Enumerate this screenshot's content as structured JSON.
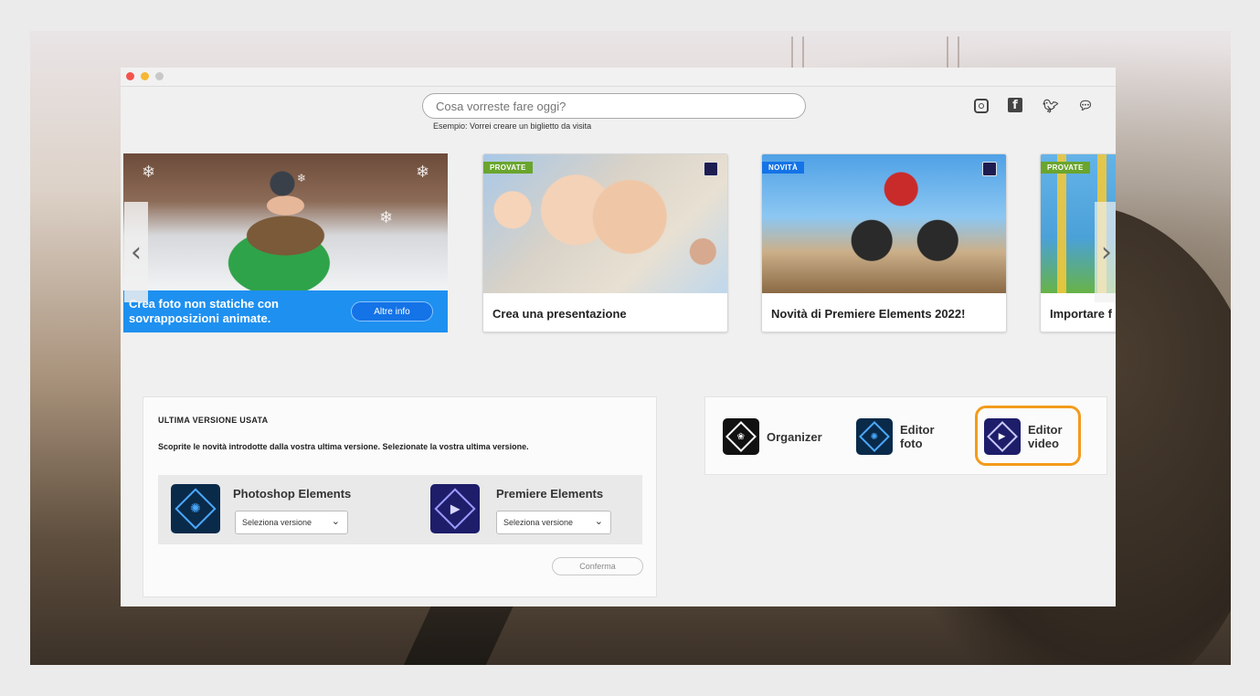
{
  "search": {
    "placeholder": "Cosa vorreste fare oggi?",
    "hint": "Esempio: Vorrei creare un biglietto da visita"
  },
  "social_icons": [
    "instagram-icon",
    "facebook-icon",
    "twitter-icon",
    "chat-icon"
  ],
  "carousel": {
    "hero": {
      "text": "Crea foto non statiche con sovrapposizioni animate.",
      "button": "Altre info"
    },
    "cards": [
      {
        "badge": "PROVATE",
        "caption": "Crea una presentazione"
      },
      {
        "badge": "NOVITÀ",
        "caption": "Novità di Premiere Elements 2022!"
      },
      {
        "badge": "PROVATE",
        "caption": "Importare f"
      }
    ],
    "prev_icon": "chevron-left-icon",
    "next_icon": "chevron-right-icon"
  },
  "last_version": {
    "title": "ULTIMA VERSIONE USATA",
    "subtitle": "Scoprite le novità introdotte dalla vostra ultima versione. Selezionate la vostra ultima versione.",
    "products": [
      {
        "name": "Photoshop Elements",
        "select": "Seleziona versione"
      },
      {
        "name": "Premiere Elements",
        "select": "Seleziona versione"
      }
    ],
    "confirm": "Conferma"
  },
  "launchers": {
    "organizer": "Organizer",
    "photo_editor_line1": "Editor",
    "photo_editor_line2": "foto",
    "video_editor_line1": "Editor",
    "video_editor_line2": "video"
  },
  "colors": {
    "accent_blue": "#1473e6",
    "banner_blue": "#1e90f0",
    "highlight_orange": "#f39b1c",
    "badge_green": "#6aa52e"
  }
}
